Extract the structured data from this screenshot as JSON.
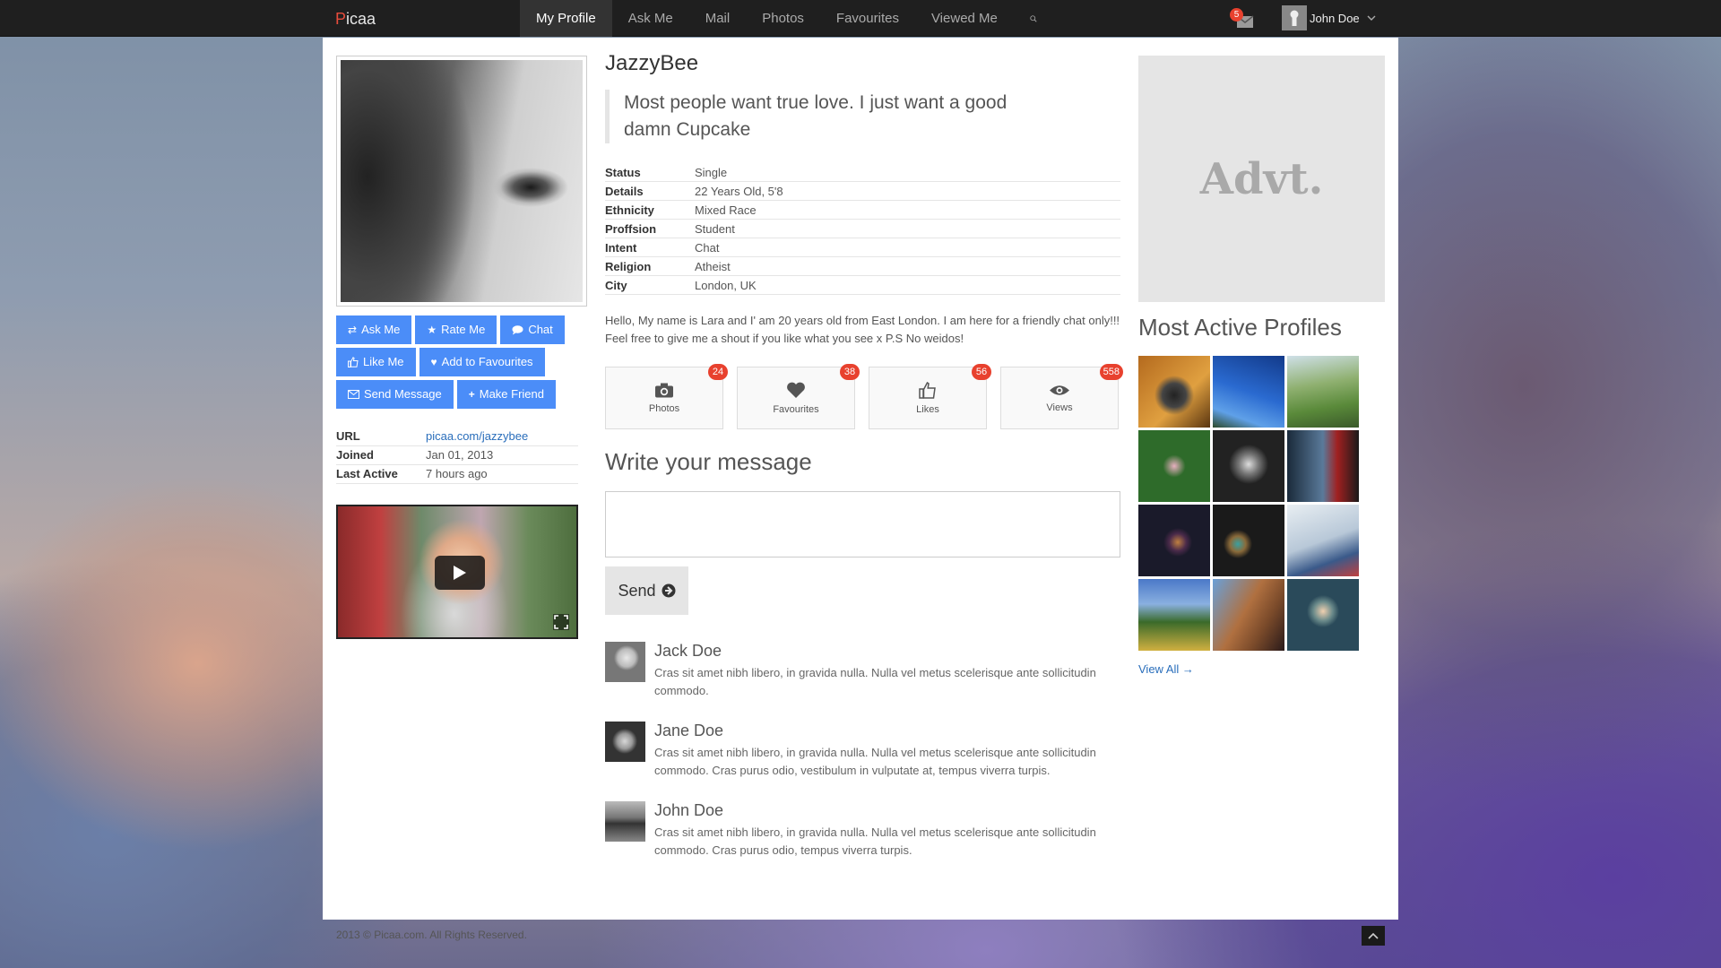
{
  "nav": {
    "brand_first": "P",
    "brand_rest": "icaa",
    "items": [
      {
        "label": "My Profile"
      },
      {
        "label": "Ask Me"
      },
      {
        "label": "Mail"
      },
      {
        "label": "Photos"
      },
      {
        "label": "Favourites"
      },
      {
        "label": "Viewed Me"
      }
    ],
    "mail_count": "5",
    "user_name": "John Doe"
  },
  "profile": {
    "username": "JazzyBee",
    "quote": "Most people want true love. I just want a good damn Cupcake",
    "buttons": {
      "ask_me": "Ask Me",
      "rate_me": "Rate Me",
      "chat": "Chat",
      "like_me": "Like Me",
      "add_fav": "Add to Favourites",
      "send_message": "Send Message",
      "make_friend": "Make Friend"
    },
    "meta": [
      {
        "key": "URL",
        "value": "picaa.com/jazzybee"
      },
      {
        "key": "Joined",
        "value": "Jan 01, 2013"
      },
      {
        "key": "Last Active",
        "value": "7 hours ago"
      }
    ],
    "info": [
      {
        "key": "Status",
        "value": "Single"
      },
      {
        "key": "Details",
        "value": "22 Years Old, 5'8"
      },
      {
        "key": "Ethnicity",
        "value": "Mixed Race"
      },
      {
        "key": "Proffsion",
        "value": "Student"
      },
      {
        "key": "Intent",
        "value": "Chat"
      },
      {
        "key": "Religion",
        "value": "Atheist"
      },
      {
        "key": "City",
        "value": "London, UK"
      }
    ],
    "bio": "Hello, My name is Lara and I' am 20 years old from East London. I am here for a friendly chat only!!! Feel free to give me a shout if you like what you see x P.S No weidos!",
    "stats": [
      {
        "label": "Photos",
        "count": "24",
        "icon": "camera-icon"
      },
      {
        "label": "Favourites",
        "count": "38",
        "icon": "heart-icon"
      },
      {
        "label": "Likes",
        "count": "56",
        "icon": "thumbs-up-icon"
      },
      {
        "label": "Views",
        "count": "558",
        "icon": "eye-icon"
      }
    ]
  },
  "message": {
    "title": "Write your message",
    "textarea_value": "",
    "send_label": "Send"
  },
  "comments": [
    {
      "name": "Jack Doe",
      "text": "Cras sit amet nibh libero, in gravida nulla. Nulla vel metus scelerisque ante sollicitudin commodo."
    },
    {
      "name": "Jane Doe",
      "text": "Cras sit amet nibh libero, in gravida nulla. Nulla vel metus scelerisque ante sollicitudin commodo. Cras purus odio, vestibulum in vulputate at, tempus viverra turpis."
    },
    {
      "name": "John Doe",
      "text": "Cras sit amet nibh libero, in gravida nulla. Nulla vel metus scelerisque ante sollicitudin commodo. Cras purus odio, tempus viverra turpis."
    }
  ],
  "sidebar": {
    "advt": "Advt.",
    "most_active_title": "Most Active Profiles",
    "view_all": "View All →"
  },
  "footer": {
    "copyright": "2013 © Picaa.com. All Rights Reserved."
  },
  "colors": {
    "accent_blue": "#4b8df8",
    "badge_red": "#e8412e",
    "brand_red": "#e74c3c",
    "navbar": "#1f1f1f"
  }
}
